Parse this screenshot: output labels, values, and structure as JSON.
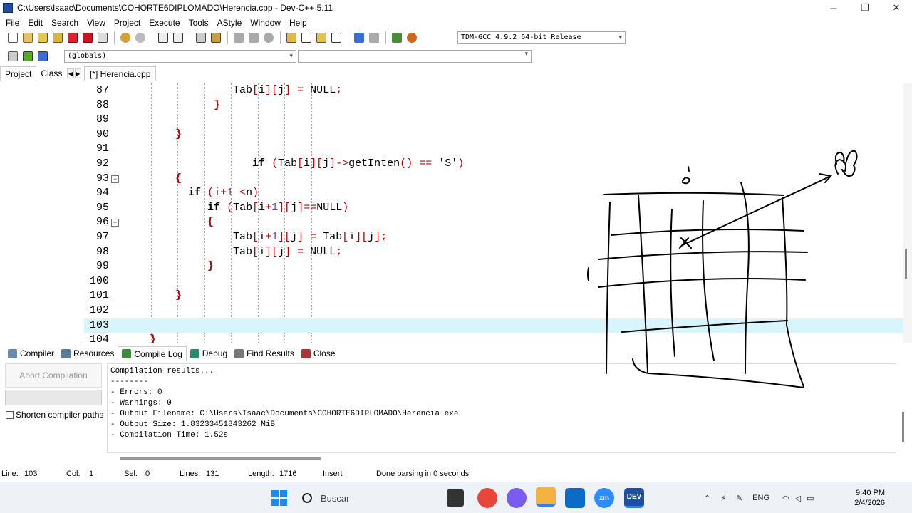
{
  "window": {
    "title": "C:\\Users\\Isaac\\Documents\\COHORTE6DIPLOMADO\\Herencia.cpp - Dev-C++ 5.11",
    "minimize": "─",
    "maximize": "❐",
    "close": "✕"
  },
  "menu": [
    "File",
    "Edit",
    "Search",
    "View",
    "Project",
    "Execute",
    "Tools",
    "AStyle",
    "Window",
    "Help"
  ],
  "toolbar": {
    "compiler": "TDM-GCC 4.9.2 64-bit Release",
    "globals": "(globals)"
  },
  "left_tabs": {
    "project": "Project",
    "classes": "Class"
  },
  "file_tab": "[*] Herencia.cpp",
  "editor": {
    "lines": [
      {
        "n": "87",
        "code": "                 Tab[i][j] = NULL;"
      },
      {
        "n": "88",
        "code": "              }"
      },
      {
        "n": "89",
        "code": ""
      },
      {
        "n": "90",
        "code": "        }"
      },
      {
        "n": "91",
        "code": ""
      },
      {
        "n": "92",
        "code": "                    if (Tab[i][j]->getInten() == 'S')"
      },
      {
        "n": "93",
        "code": "        {"
      },
      {
        "n": "94",
        "code": "          if (i+1 <n)"
      },
      {
        "n": "95",
        "code": "             if (Tab[i+1][j]==NULL)"
      },
      {
        "n": "96",
        "code": "             {"
      },
      {
        "n": "97",
        "code": "                 Tab[i+1][j] = Tab[i][j];"
      },
      {
        "n": "98",
        "code": "                 Tab[i][j] = NULL;"
      },
      {
        "n": "99",
        "code": "             }"
      },
      {
        "n": "100",
        "code": ""
      },
      {
        "n": "101",
        "code": "        }"
      },
      {
        "n": "102",
        "code": ""
      },
      {
        "n": "103",
        "code": ""
      },
      {
        "n": "104",
        "code": "    }"
      }
    ]
  },
  "bottom_tabs": [
    "Compiler",
    "Resources",
    "Compile Log",
    "Debug",
    "Find Results",
    "Close"
  ],
  "bottom": {
    "abort": "Abort Compilation",
    "shorten": "Shorten compiler paths",
    "log": [
      "Compilation results...",
      "--------",
      "- Errors: 0",
      "- Warnings: 0",
      "- Output Filename: C:\\Users\\Isaac\\Documents\\COHORTE6DIPLOMADO\\Herencia.exe",
      "- Output Size: 1.83233451843262 MiB",
      "- Compilation Time: 1.52s"
    ]
  },
  "status": {
    "line": "Line:",
    "line_val": "103",
    "col": "Col:",
    "col_val": "1",
    "sel": "Sel:",
    "sel_val": "0",
    "lines": "Lines:",
    "lines_val": "131",
    "length": "Length:",
    "length_val": "1716",
    "mode": "Insert",
    "parse": "Done parsing in 0 seconds"
  },
  "taskbar": {
    "search": "Buscar",
    "lang": "ENG",
    "time": "9:40 PM",
    "date": "2/4/2026"
  }
}
